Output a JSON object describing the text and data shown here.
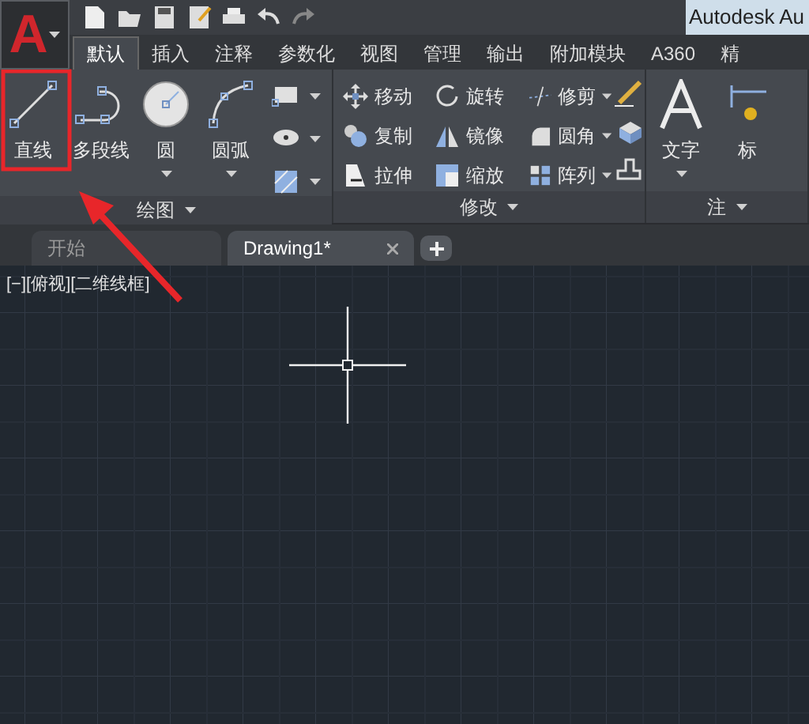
{
  "app_button": {
    "letter": "A"
  },
  "title": "Autodesk Au",
  "ribbon_tabs": [
    {
      "label": "默认",
      "selected": true
    },
    {
      "label": "插入",
      "selected": false
    },
    {
      "label": "注释",
      "selected": false
    },
    {
      "label": "参数化",
      "selected": false
    },
    {
      "label": "视图",
      "selected": false
    },
    {
      "label": "管理",
      "selected": false
    },
    {
      "label": "输出",
      "selected": false
    },
    {
      "label": "附加模块",
      "selected": false
    },
    {
      "label": "A360",
      "selected": false
    },
    {
      "label": "精",
      "selected": false
    }
  ],
  "draw_panel": {
    "title": "绘图",
    "tools": [
      {
        "label": "直线",
        "kind": "line",
        "dropdown": false
      },
      {
        "label": "多段线",
        "kind": "polyline",
        "dropdown": false
      },
      {
        "label": "圆",
        "kind": "circle",
        "dropdown": true
      },
      {
        "label": "圆弧",
        "kind": "arc",
        "dropdown": true
      }
    ]
  },
  "modify_panel": {
    "title": "修改",
    "tools": [
      {
        "label": "移动",
        "kind": "move",
        "dropdown": false
      },
      {
        "label": "旋转",
        "kind": "rotate",
        "dropdown": false
      },
      {
        "label": "修剪",
        "kind": "trim",
        "dropdown": true
      },
      {
        "label": "复制",
        "kind": "copy",
        "dropdown": false
      },
      {
        "label": "镜像",
        "kind": "mirror",
        "dropdown": false
      },
      {
        "label": "圆角",
        "kind": "fillet",
        "dropdown": true
      },
      {
        "label": "拉伸",
        "kind": "stretch",
        "dropdown": false
      },
      {
        "label": "缩放",
        "kind": "scale",
        "dropdown": false
      },
      {
        "label": "阵列",
        "kind": "array",
        "dropdown": true
      }
    ]
  },
  "annotation_panel": {
    "title": "注",
    "tools": [
      {
        "label": "文字",
        "kind": "text",
        "dropdown": true
      },
      {
        "label": "标",
        "kind": "dimension",
        "dropdown": false
      }
    ]
  },
  "file_tabs": [
    {
      "label": "开始",
      "selected": false,
      "closable": false
    },
    {
      "label": "Drawing1*",
      "selected": true,
      "closable": true
    }
  ],
  "viewport_label": "[−][俯视][二维线框]"
}
